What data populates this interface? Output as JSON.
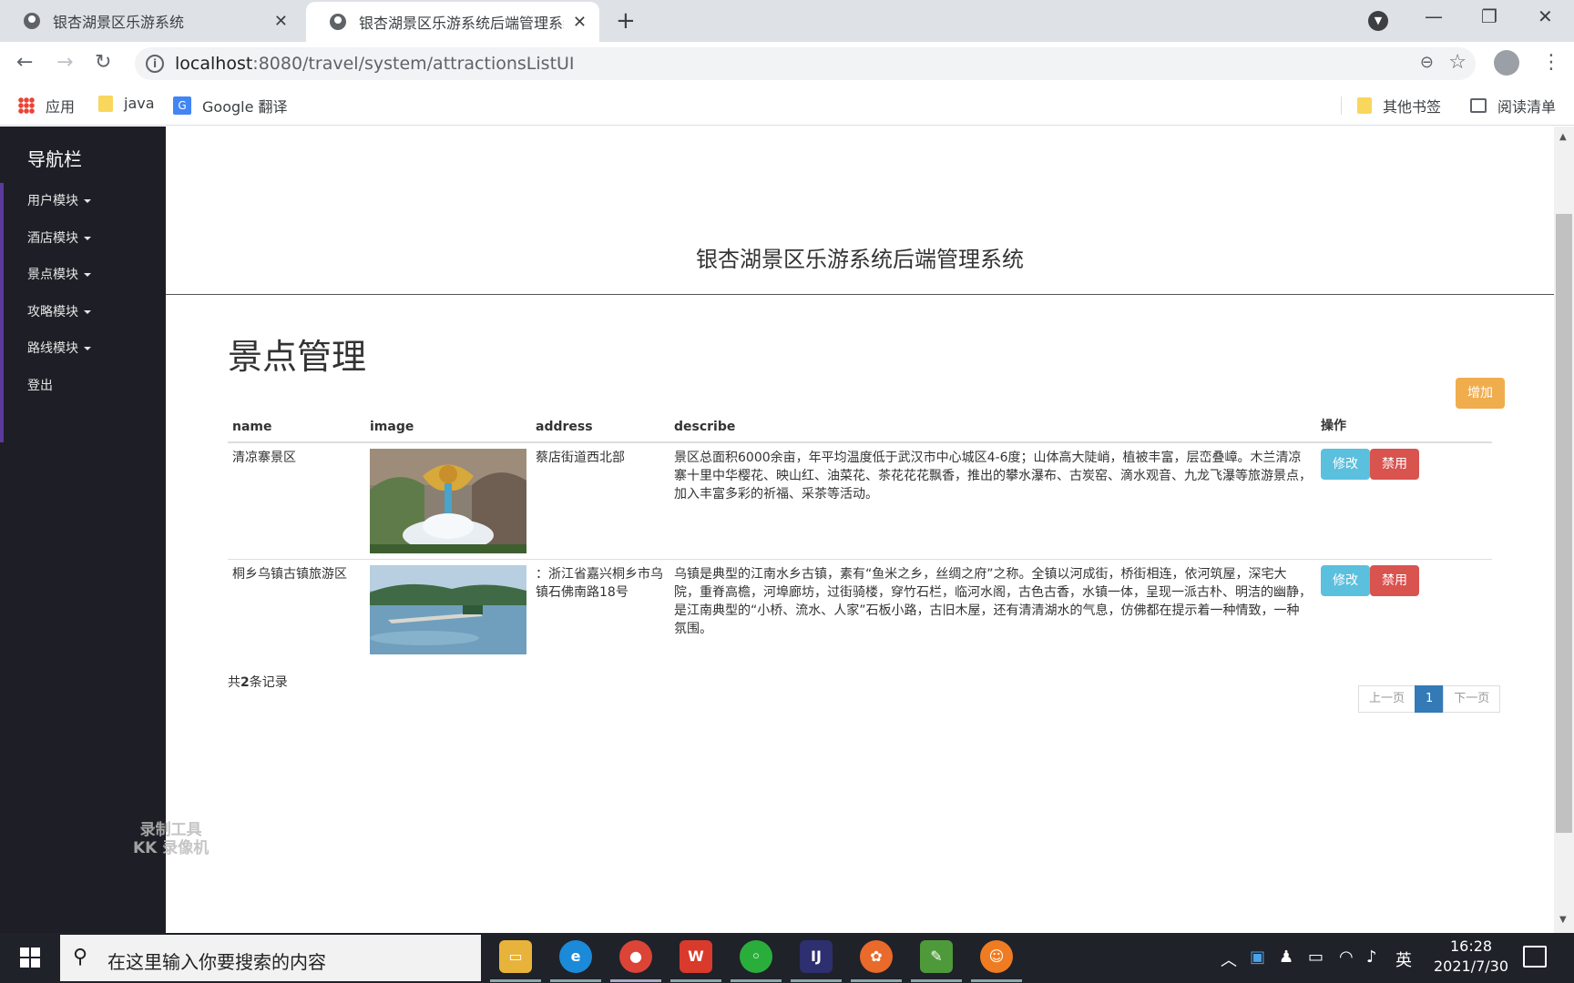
{
  "browser": {
    "tabs": [
      {
        "title": "银杏湖景区乐游系统",
        "active": false
      },
      {
        "title": "银杏湖景区乐游系统后端管理系统",
        "active": true
      }
    ],
    "url_host": "localhost",
    "url_path": ":8080/travel/system/attractionsListUI",
    "bookmarks": [
      {
        "label": "应用",
        "icon": "apps-icon"
      },
      {
        "label": "java",
        "icon": "folder-icon"
      },
      {
        "label": "Google 翻译",
        "icon": "google-translate-icon"
      }
    ],
    "bookmarks_right": [
      {
        "label": "其他书签",
        "icon": "folder-icon"
      },
      {
        "label": "阅读清单",
        "icon": "reading-list-icon"
      }
    ]
  },
  "sidebar": {
    "brand": "导航栏",
    "items": [
      {
        "label": "用户模块",
        "has_caret": true
      },
      {
        "label": "酒店模块",
        "has_caret": true
      },
      {
        "label": "景点模块",
        "has_caret": true
      },
      {
        "label": "攻略模块",
        "has_caret": true
      },
      {
        "label": "路线模块",
        "has_caret": true
      },
      {
        "label": "登出",
        "has_caret": false
      }
    ]
  },
  "header": {
    "site_title": "银杏湖景区乐游系统后端管理系统"
  },
  "main": {
    "page_title": "景点管理",
    "add_button": "增加",
    "columns": [
      "name",
      "image",
      "address",
      "describe",
      "操作"
    ],
    "rows": [
      {
        "name": "清凉寨景区",
        "image": "dragon-fountain-photo",
        "address": "蔡店街道西北部",
        "describe": "景区总面积6000余亩，年平均温度低于武汉市中心城区4-6度；山体高大陡峭，植被丰富，层峦叠嶂。木兰清凉寨十里中华樱花、映山红、油菜花、茶花花花飘香，推出的攀水瀑布、古炭窑、滴水观音、九龙飞瀑等旅游景点，加入丰富多彩的祈福、采茶等活动。",
        "edit_label": "修改",
        "ban_label": "禁用"
      },
      {
        "name": "桐乡乌镇古镇旅游区",
        "image": "lake-town-photo",
        "address": "：浙江省嘉兴桐乡市乌镇石佛南路18号",
        "describe": "乌镇是典型的江南水乡古镇，素有“鱼米之乡，丝绸之府”之称。全镇以河成街，桥街相连，依河筑屋，深宅大院，重脊高檐，河埠廊坊，过街骑楼，穿竹石栏，临河水阁，古色古香，水镇一体，呈现一派古朴、明洁的幽静，是江南典型的“小桥、流水、人家”石板小路，古旧木屋，还有清清湖水的气息，仿佛都在提示着一种情致，一种氛围。",
        "edit_label": "修改",
        "ban_label": "禁用"
      }
    ],
    "total_prefix": "共",
    "total_count": "2",
    "total_suffix": "条记录",
    "pager": {
      "prev": "上一页",
      "current": "1",
      "next": "下一页"
    }
  },
  "watermark": {
    "line1": "录制工具",
    "line2": "KK 录像机"
  },
  "taskbar": {
    "search_placeholder": "在这里输入你要搜索的内容",
    "ime": "英",
    "time": "16:28",
    "date": "2021/7/30"
  },
  "colors": {
    "sidebar_bg": "#1e1f26",
    "add_button": "#f0ad4e",
    "edit_button": "#5bc0de",
    "ban_button": "#d9534f",
    "pager_active": "#337ab7"
  }
}
